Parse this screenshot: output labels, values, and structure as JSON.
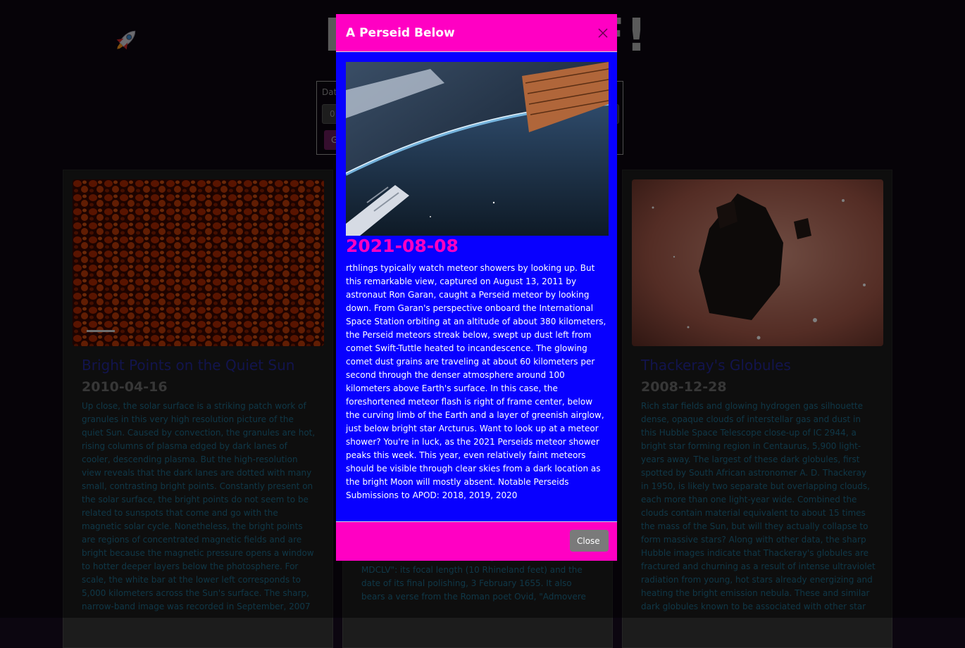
{
  "header": {
    "logo_icon": "rocket-icon",
    "title_left": "E",
    "title_right": "F!"
  },
  "search": {
    "label": "Dat",
    "input_value": "0",
    "button_label": "G"
  },
  "cards": [
    {
      "title": "Bright Points on the Quiet Sun",
      "date": "2010-04-16",
      "text": "Up close, the solar surface is a striking patch work of granules in this very high resolution picture of the quiet Sun. Caused by convection, the granules are hot, rising columns of plasma edged by dark lanes of cooler, descending plasma. But the high-resolution view reveals that the dark lanes are dotted with many small, contrasting bright points. Constantly present on the solar surface, the bright points do not seem to be related to sunspots that come and go with the magnetic solar cycle. Nonetheless, the bright points are regions of concentrated magnetic fields and are bright because the magnetic pressure opens a window to hotter deeper layers below the photosphere. For scale, the white bar at the lower left corresponds to 5,000 kilometers across the Sun's surface. The sharp, narrow-band image was recorded in September, 2007"
    },
    {
      "text": "diameter and is inscribed along the border \"X 3 FEBR. MDCLV\": its focal length (10 Rhineland feet) and the date of its final polishing, 3 February 1655. It also bears a verse from the Roman poet Ovid, \"Admovere"
    },
    {
      "title": "Thackeray's Globules",
      "date": "2008-12-28",
      "text": "Rich star fields and glowing hydrogen gas silhouette dense, opaque clouds of interstellar gas and dust in this Hubble Space Telescope close-up of IC 2944, a bright star forming region in Centaurus, 5,900 light-years away. The largest of these dark globules, first spotted by South African astronomer A. D. Thackeray in 1950, is likely two separate but overlapping clouds, each more than one light-year wide. Combined the clouds contain material equivalent to about 15 times the mass of the Sun, but will they actually collapse to form massive stars? Along with other data, the sharp Hubble images indicate that Thackeray's globules are fractured and churning as a result of intense ultraviolet radiation from young, hot stars already energizing and heating the bright emission nebula. These and similar dark globules known to be associated with other star"
    }
  ],
  "modal": {
    "title": "A Perseid Below",
    "date": "2021-08-08",
    "text": "rthlings typically watch meteor showers by looking up. But this remarkable view, captured on August 13, 2011 by astronaut Ron Garan, caught a Perseid meteor by looking down. From Garan's perspective onboard the International Space Station orbiting at an altitude of about 380 kilometers, the Perseid meteors streak below, swept up dust left from comet Swift-Tuttle heated to incandescence. The glowing comet dust grains are traveling at about 60 kilometers per second through the denser atmosphere around 100 kilometers above Earth's surface. In this case, the foreshortened meteor flash is right of frame center, below the curving limb of the Earth and a layer of greenish airglow, just below bright star Arcturus. Want to look up at a meteor shower? You're in luck, as the 2021 Perseids meteor shower peaks this week. This year, even relatively faint meteors should be visible through clear skies from a dark location as the bright Moon will mostly absent. Notable Perseids Submissions to APOD: 2018, 2019, 2020",
    "close_label": "Close",
    "close_icon": "close-icon"
  },
  "colors": {
    "modal_header": "#ff00c3",
    "modal_body": "#0800ff",
    "card_title": "#24289a",
    "card_text": "#1f6f8e"
  }
}
